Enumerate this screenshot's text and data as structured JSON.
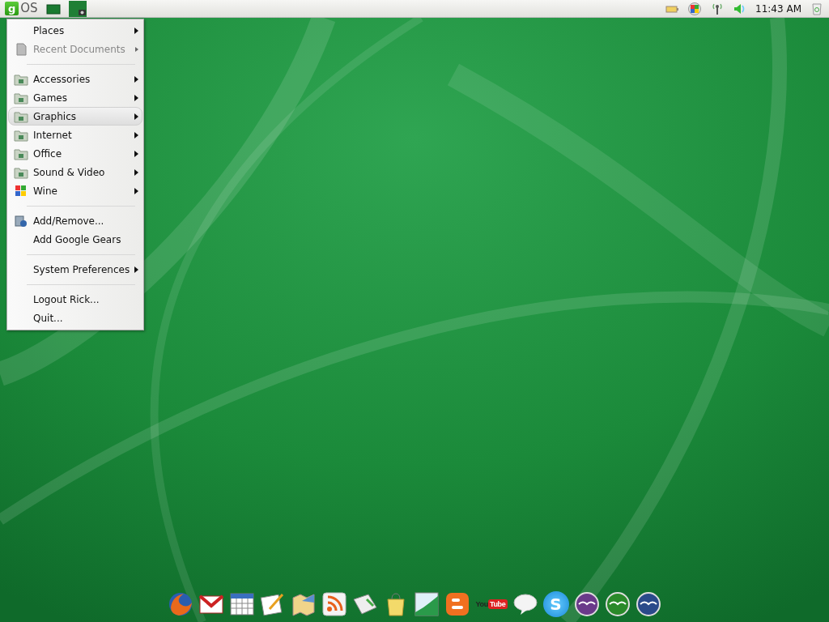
{
  "panel": {
    "logo": {
      "badge": "g",
      "text": "OS"
    },
    "taskbar": [
      {
        "kind": "window"
      },
      {
        "kind": "camera-window"
      }
    ],
    "tray": [
      {
        "kind": "battery"
      },
      {
        "kind": "flag"
      },
      {
        "kind": "signal"
      },
      {
        "kind": "volume"
      }
    ],
    "clock": "11:43 AM"
  },
  "menu": {
    "items": [
      {
        "kind": "plain",
        "label": "Places",
        "submenu": true,
        "disabled": false,
        "selected": false
      },
      {
        "kind": "document",
        "label": "Recent Documents",
        "submenu": true,
        "disabled": true,
        "selected": false
      },
      {
        "kind": "separator"
      },
      {
        "kind": "folder",
        "label": "Accessories",
        "submenu": true,
        "disabled": false,
        "selected": false
      },
      {
        "kind": "folder",
        "label": "Games",
        "submenu": true,
        "disabled": false,
        "selected": false
      },
      {
        "kind": "folder",
        "label": "Graphics",
        "submenu": true,
        "disabled": false,
        "selected": true
      },
      {
        "kind": "folder",
        "label": "Internet",
        "submenu": true,
        "disabled": false,
        "selected": false
      },
      {
        "kind": "folder",
        "label": "Office",
        "submenu": true,
        "disabled": false,
        "selected": false
      },
      {
        "kind": "folder",
        "label": "Sound & Video",
        "submenu": true,
        "disabled": false,
        "selected": false
      },
      {
        "kind": "flag",
        "label": "Wine",
        "submenu": true,
        "disabled": false,
        "selected": false
      },
      {
        "kind": "separator"
      },
      {
        "kind": "package",
        "label": "Add/Remove...",
        "submenu": false,
        "disabled": false,
        "selected": false
      },
      {
        "kind": "plain",
        "label": "Add Google Gears",
        "submenu": false,
        "disabled": false,
        "selected": false
      },
      {
        "kind": "separator"
      },
      {
        "kind": "plain",
        "label": "System Preferences",
        "submenu": true,
        "disabled": false,
        "selected": false
      },
      {
        "kind": "separator"
      },
      {
        "kind": "plain",
        "label": "Logout Rick...",
        "submenu": false,
        "disabled": false,
        "selected": false
      },
      {
        "kind": "plain",
        "label": "Quit...",
        "submenu": false,
        "disabled": false,
        "selected": false
      }
    ]
  },
  "dock": [
    {
      "kind": "browser"
    },
    {
      "kind": "mail"
    },
    {
      "kind": "calendar"
    },
    {
      "kind": "notepad"
    },
    {
      "kind": "map"
    },
    {
      "kind": "feed"
    },
    {
      "kind": "newspaper"
    },
    {
      "kind": "bag"
    },
    {
      "kind": "chart"
    },
    {
      "kind": "blog"
    },
    {
      "kind": "video",
      "text": [
        "You",
        "Tube"
      ]
    },
    {
      "kind": "chat"
    },
    {
      "kind": "phone",
      "text": [
        "S"
      ]
    },
    {
      "kind": "seagull-purple"
    },
    {
      "kind": "seagull-green"
    },
    {
      "kind": "seagull-blue"
    }
  ]
}
